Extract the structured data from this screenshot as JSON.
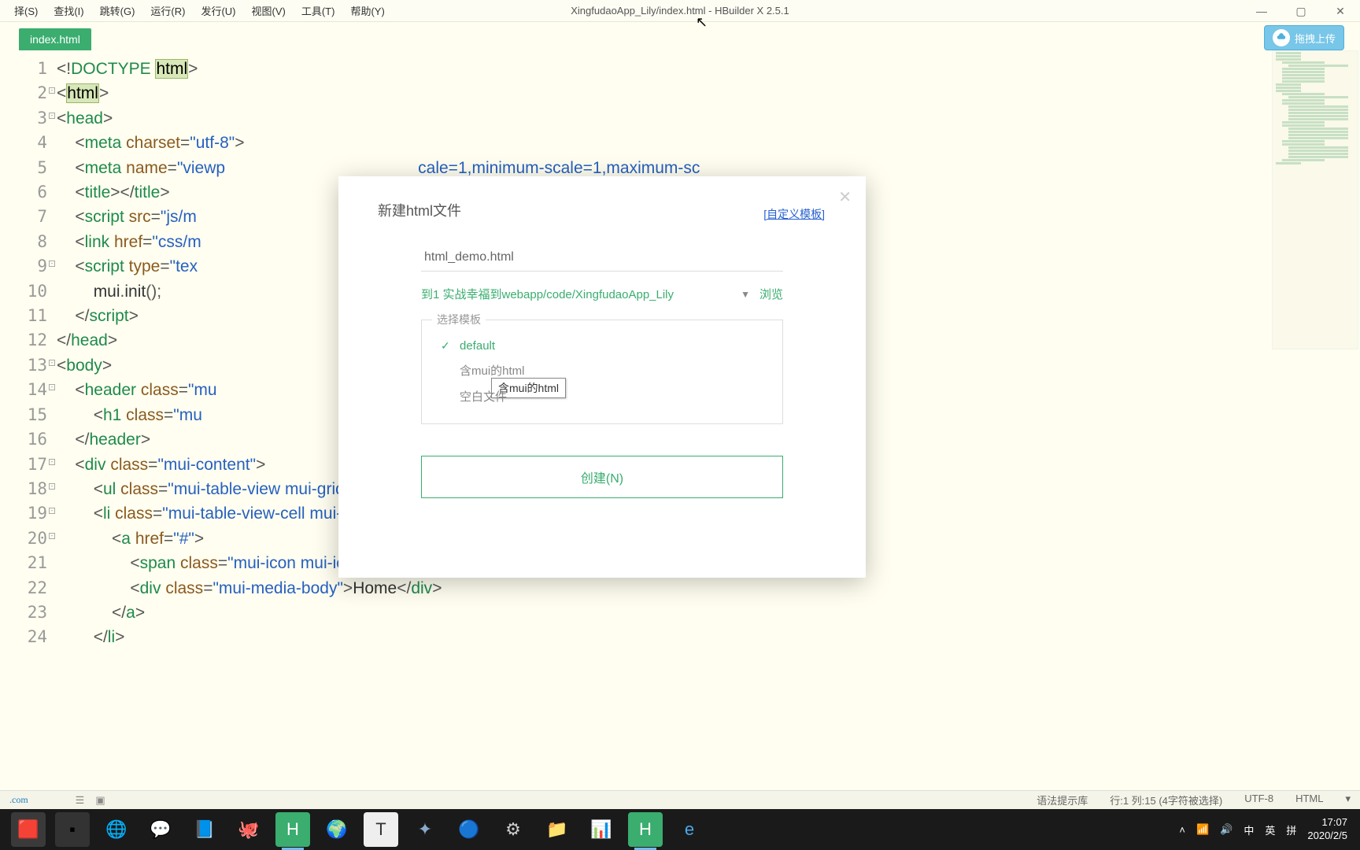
{
  "menubar": {
    "items": [
      "择(S)",
      "查找(I)",
      "跳转(G)",
      "运行(R)",
      "发行(U)",
      "视图(V)",
      "工具(T)",
      "帮助(Y)"
    ],
    "title": "XingfudaoApp_Lily/index.html - HBuilder X 2.5.1"
  },
  "tabs": {
    "active": "index.html"
  },
  "upload": {
    "label": "拖拽上传"
  },
  "code_lines": [
    {
      "n": "1",
      "html": "<span class='pun'>&lt;!</span><span class='tag'>DOCTYPE</span> <span class='hl'>html</span><span class='pun'>&gt;</span>"
    },
    {
      "n": "2",
      "fold": true,
      "html": "<span class='pun'>&lt;</span><span class='hl'>html</span><span class='pun'>&gt;</span>"
    },
    {
      "n": "3",
      "fold": true,
      "html": "<span class='pun'>&lt;</span><span class='tag'>head</span><span class='pun'>&gt;</span>"
    },
    {
      "n": "4",
      "html": "    <span class='pun'>&lt;</span><span class='tag'>meta</span> <span class='attr'>charset</span><span class='pun'>=</span><span class='str'>\"utf-8\"</span><span class='pun'>&gt;</span>"
    },
    {
      "n": "5",
      "html": "    <span class='pun'>&lt;</span><span class='tag'>meta</span> <span class='attr'>name</span><span class='pun'>=</span><span class='str'>\"viewp</span>                                          <span class='str'>cale=1,minimum-scale=1,maximum-sc</span>"
    },
    {
      "n": "6",
      "html": "    <span class='pun'>&lt;</span><span class='tag'>title</span><span class='pun'>&gt;&lt;/</span><span class='tag'>title</span><span class='pun'>&gt;</span>"
    },
    {
      "n": "7",
      "html": "    <span class='pun'>&lt;</span><span class='tag'>script</span> <span class='attr'>src</span><span class='pun'>=</span><span class='str'>\"js/m</span>"
    },
    {
      "n": "8",
      "html": "    <span class='pun'>&lt;</span><span class='tag'>link</span> <span class='attr'>href</span><span class='pun'>=</span><span class='str'>\"css/m</span>"
    },
    {
      "n": "9",
      "fold": true,
      "html": "    <span class='pun'>&lt;</span><span class='tag'>script</span> <span class='attr'>type</span><span class='pun'>=</span><span class='str'>\"tex</span>"
    },
    {
      "n": "10",
      "html": "        <span class='txt'>mui</span><span class='pun'>.</span><span class='txt'>init</span><span class='pun'>();</span>"
    },
    {
      "n": "11",
      "html": "    <span class='pun'>&lt;/</span><span class='tag'>script</span><span class='pun'>&gt;</span>"
    },
    {
      "n": "12",
      "html": "<span class='pun'>&lt;/</span><span class='tag'>head</span><span class='pun'>&gt;</span>"
    },
    {
      "n": "13",
      "fold": true,
      "html": "<span class='pun'>&lt;</span><span class='tag'>body</span><span class='pun'>&gt;</span>"
    },
    {
      "n": "14",
      "fold": true,
      "html": "    <span class='pun'>&lt;</span><span class='tag'>header</span> <span class='attr'>class</span><span class='pun'>=</span><span class='str'>\"mu</span>"
    },
    {
      "n": "15",
      "html": "        <span class='pun'>&lt;</span><span class='tag'>h1</span> <span class='attr'>class</span><span class='pun'>=</span><span class='str'>\"mu</span>"
    },
    {
      "n": "16",
      "html": "    <span class='pun'>&lt;/</span><span class='tag'>header</span><span class='pun'>&gt;</span>"
    },
    {
      "n": "17",
      "fold": true,
      "html": "    <span class='pun'>&lt;</span><span class='tag'>div</span> <span class='attr'>class</span><span class='pun'>=</span><span class='str'>\"mui-content\"</span><span class='pun'>&gt;</span>"
    },
    {
      "n": "18",
      "fold": true,
      "html": "        <span class='pun'>&lt;</span><span class='tag'>ul</span> <span class='attr'>class</span><span class='pun'>=</span><span class='str'>\"mui-table-view mui-grid-view mui-grid-9\"</span><span class='pun'>&gt;</span>"
    },
    {
      "n": "19",
      "fold": true,
      "html": "        <span class='pun'>&lt;</span><span class='tag'>li</span> <span class='attr'>class</span><span class='pun'>=</span><span class='str'>\"mui-table-view-cell mui-media mui-col-xs-4 mui-col-sm-3\"</span><span class='pun'>&gt;</span>"
    },
    {
      "n": "20",
      "fold": true,
      "html": "            <span class='pun'>&lt;</span><span class='tag'>a</span> <span class='attr'>href</span><span class='pun'>=</span><span class='str'>\"#\"</span><span class='pun'>&gt;</span>"
    },
    {
      "n": "21",
      "html": "                <span class='pun'>&lt;</span><span class='tag'>span</span> <span class='attr'>class</span><span class='pun'>=</span><span class='str'>\"mui-icon mui-icon-home\"</span><span class='pun'>&gt;&lt;/</span><span class='tag'>span</span><span class='pun'>&gt;</span>"
    },
    {
      "n": "22",
      "html": "                <span class='pun'>&lt;</span><span class='tag'>div</span> <span class='attr'>class</span><span class='pun'>=</span><span class='str'>\"mui-media-body\"</span><span class='pun'>&gt;</span><span class='txt'>Home</span><span class='pun'>&lt;/</span><span class='tag'>div</span><span class='pun'>&gt;</span>"
    },
    {
      "n": "23",
      "html": "            <span class='pun'>&lt;/</span><span class='tag'>a</span><span class='pun'>&gt;</span>"
    },
    {
      "n": "24",
      "html": "        <span class='pun'>&lt;/</span><span class='tag'>li</span><span class='pun'>&gt;</span>"
    }
  ],
  "dialog": {
    "title": "新建html文件",
    "custom_link": "[自定义模板]",
    "filename": "html_demo.html",
    "path": "到1 实战幸福到webapp/code/XingfudaoApp_Lily",
    "browse": "浏览",
    "template_label": "选择模板",
    "templates": [
      {
        "name": "default",
        "checked": true
      },
      {
        "name": "含mui的html",
        "checked": false
      },
      {
        "name": "空白文件",
        "checked": false
      }
    ],
    "tooltip": "含mui的html",
    "create": "创建(N)"
  },
  "status": {
    "left": ".com",
    "hint": "语法提示库",
    "cursor": "行:1 列:15 (4字符被选择)",
    "encoding": "UTF-8",
    "lang": "HTML"
  },
  "tray": {
    "ime1": "中",
    "ime2": "英",
    "ime3": "拼",
    "time": "17:07",
    "date": "2020/2/5"
  }
}
